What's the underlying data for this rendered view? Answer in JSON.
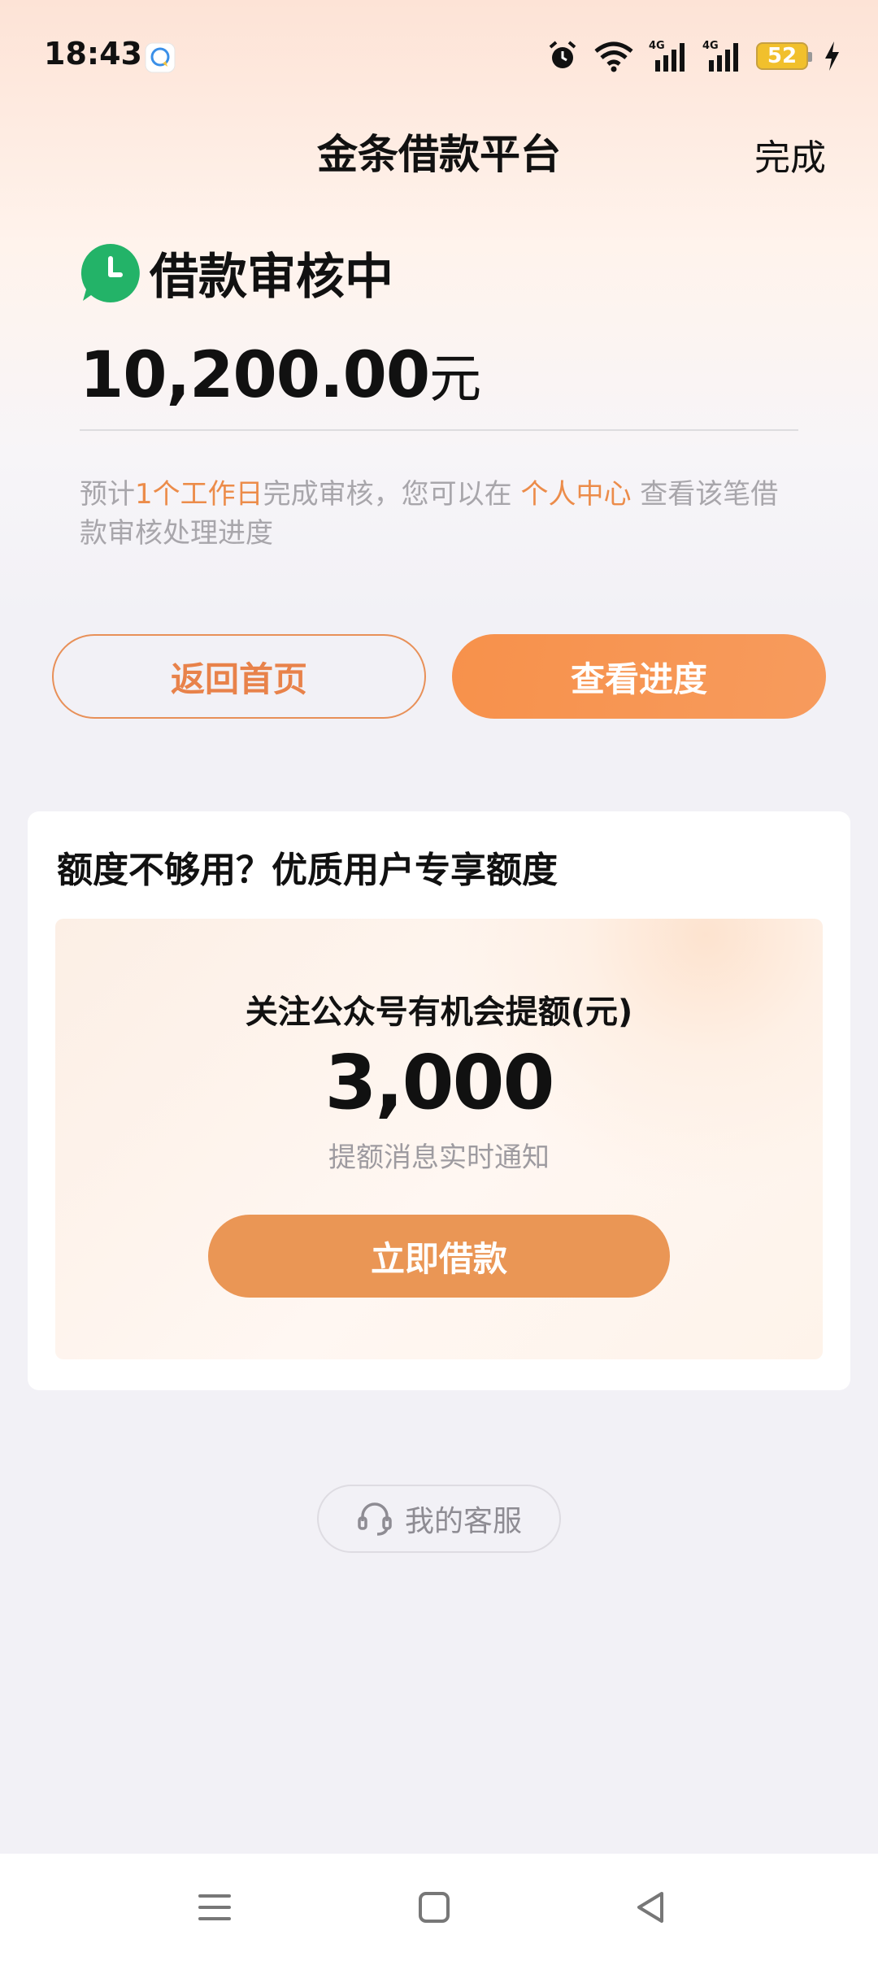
{
  "status_bar": {
    "time": "18:43",
    "battery": "52",
    "icons": [
      "qq-notification-icon",
      "alarm-icon",
      "wifi-icon",
      "signal-4g-icon",
      "signal-4g-icon",
      "battery-icon",
      "charging-icon"
    ]
  },
  "header": {
    "title": "金条借款平台",
    "done_label": "完成"
  },
  "status": {
    "icon": "clock-icon",
    "label": "借款审核中",
    "amount": "10,200.00",
    "unit": "元"
  },
  "hint": {
    "part1": "预计",
    "highlight1": "1个工作日",
    "part2": "完成审核，您可以在 ",
    "highlight2": "个人中心",
    "part3": " 查看该笔借款审核处理进度"
  },
  "buttons": {
    "home": "返回首页",
    "progress": "查看进度"
  },
  "promo_card": {
    "title": "额度不够用？优质用户专享额度",
    "caption": "关注公众号有机会提额(元)",
    "value": "3,000",
    "subtitle": "提额消息实时通知",
    "cta": "立即借款"
  },
  "service": {
    "icon": "headset-icon",
    "label": "我的客服"
  },
  "nav": {
    "icons": [
      "menu-icon",
      "home-square-icon",
      "back-triangle-icon"
    ]
  },
  "colors": {
    "accent": "#f7914b",
    "highlight_text": "#ec8c4a",
    "status_green": "#23b368",
    "battery": "#f1c02c"
  }
}
